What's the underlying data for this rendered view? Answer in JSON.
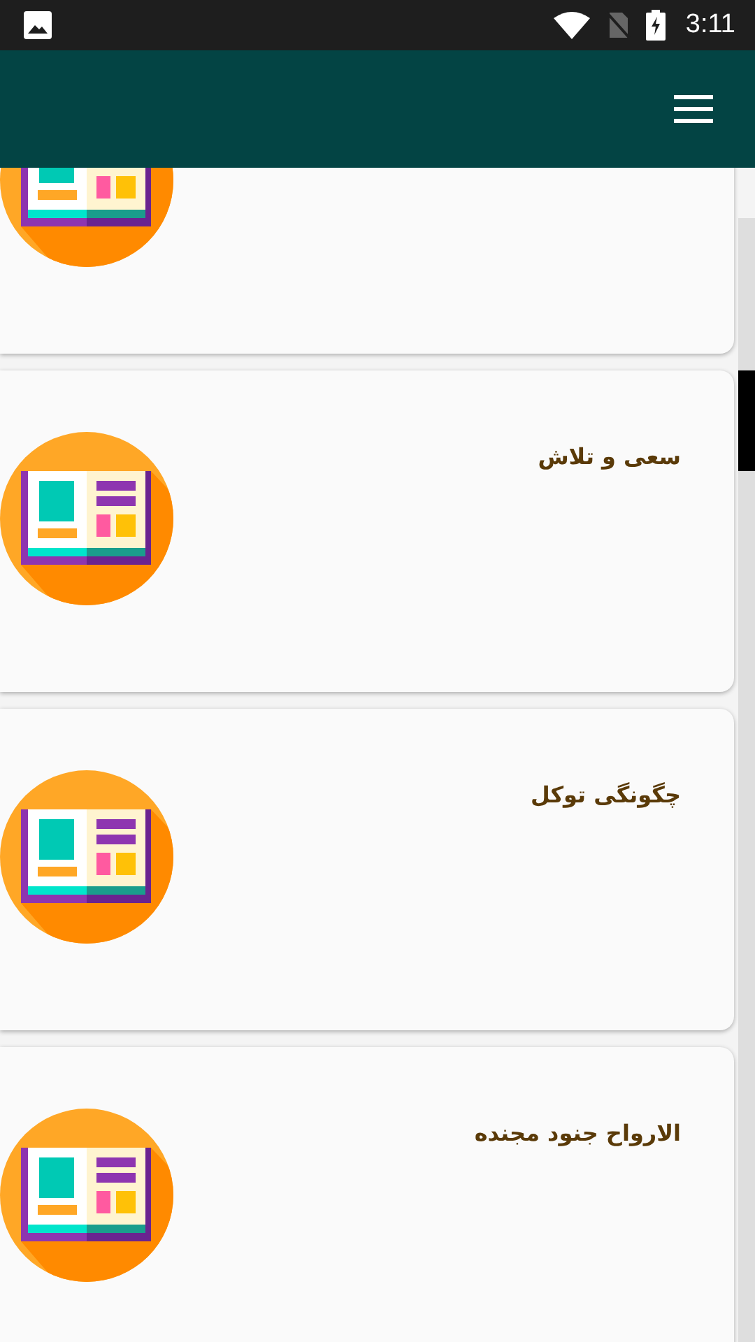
{
  "status_bar": {
    "time": "3:11"
  },
  "items": [
    {
      "partial": true
    },
    {
      "title": "سعی و تلاش"
    },
    {
      "title": "چگونگی توکل"
    },
    {
      "title": "الارواح جنود مجنده"
    }
  ]
}
